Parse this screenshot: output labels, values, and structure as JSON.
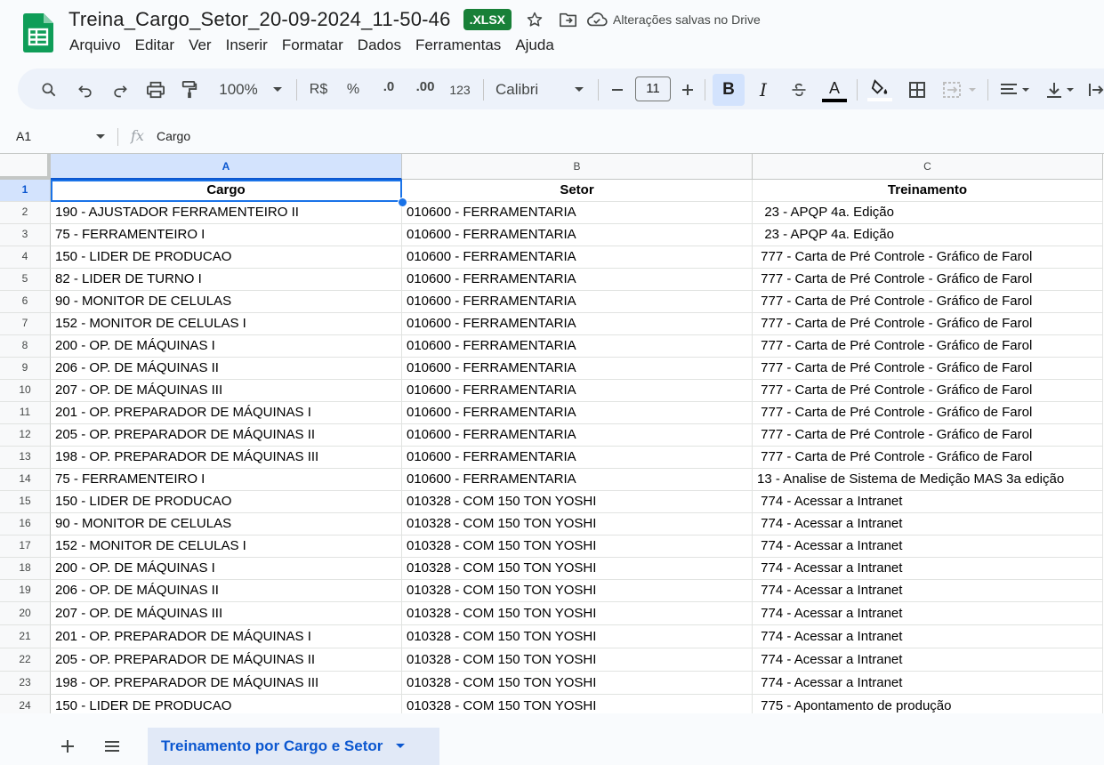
{
  "app": {
    "doc_title": "Treina_Cargo_Setor_20-09-2024_11-50-46",
    "format_badge": ".XLSX",
    "saved_status": "Alterações salvas no Drive"
  },
  "menu": [
    "Arquivo",
    "Editar",
    "Ver",
    "Inserir",
    "Formatar",
    "Dados",
    "Ferramentas",
    "Ajuda"
  ],
  "toolbar": {
    "zoom": "100%",
    "currency": "R$",
    "percent": "%",
    "decrease_decimal": ".0",
    "increase_decimal": ".00",
    "number_format": "123",
    "font": "Calibri",
    "font_size": "11",
    "bold": "B",
    "italic": "I",
    "text_color_label": "A",
    "text_color": "#000000"
  },
  "formula_bar": {
    "cell_ref": "A1",
    "fx": "fx",
    "value": "Cargo"
  },
  "columns": [
    "A",
    "B",
    "C"
  ],
  "rows": [
    {
      "n": "1",
      "a": "Cargo",
      "b": "Setor",
      "c": "Treinamento"
    },
    {
      "n": "2",
      "a": "190 - AJUSTADOR FERRAMENTEIRO II",
      "b": "010600 - FERRAMENTARIA",
      "c": "  23 - APQP 4a. Edição"
    },
    {
      "n": "3",
      "a": "75 - FERRAMENTEIRO I",
      "b": "010600 - FERRAMENTARIA",
      "c": "  23 - APQP 4a. Edição"
    },
    {
      "n": "4",
      "a": "150 - LIDER DE PRODUCAO",
      "b": "010600 - FERRAMENTARIA",
      "c": " 777 - Carta de Pré Controle - Gráfico de Farol"
    },
    {
      "n": "5",
      "a": "82 - LIDER DE TURNO I",
      "b": "010600 - FERRAMENTARIA",
      "c": " 777 - Carta de Pré Controle - Gráfico de Farol"
    },
    {
      "n": "6",
      "a": "90 - MONITOR DE CELULAS",
      "b": "010600 - FERRAMENTARIA",
      "c": " 777 - Carta de Pré Controle - Gráfico de Farol"
    },
    {
      "n": "7",
      "a": "152 - MONITOR DE CELULAS I",
      "b": "010600 - FERRAMENTARIA",
      "c": " 777 - Carta de Pré Controle - Gráfico de Farol"
    },
    {
      "n": "8",
      "a": "200 - OP. DE MÁQUINAS I",
      "b": "010600 - FERRAMENTARIA",
      "c": " 777 - Carta de Pré Controle - Gráfico de Farol"
    },
    {
      "n": "9",
      "a": "206 - OP. DE MÁQUINAS II",
      "b": "010600 - FERRAMENTARIA",
      "c": " 777 - Carta de Pré Controle - Gráfico de Farol"
    },
    {
      "n": "10",
      "a": "207 - OP. DE MÁQUINAS III",
      "b": "010600 - FERRAMENTARIA",
      "c": " 777 - Carta de Pré Controle - Gráfico de Farol"
    },
    {
      "n": "11",
      "a": "201 - OP. PREPARADOR DE MÁQUINAS I",
      "b": "010600 - FERRAMENTARIA",
      "c": " 777 - Carta de Pré Controle - Gráfico de Farol"
    },
    {
      "n": "12",
      "a": "205 - OP. PREPARADOR DE MÁQUINAS II",
      "b": "010600 - FERRAMENTARIA",
      "c": " 777 - Carta de Pré Controle - Gráfico de Farol"
    },
    {
      "n": "13",
      "a": "198 - OP. PREPARADOR DE MÁQUINAS III",
      "b": "010600 - FERRAMENTARIA",
      "c": " 777 - Carta de Pré Controle - Gráfico de Farol"
    },
    {
      "n": "14",
      "a": "75 - FERRAMENTEIRO I",
      "b": "010600 - FERRAMENTARIA",
      "c": "13 - Analise de Sistema de Medição MAS 3a edição"
    },
    {
      "n": "15",
      "a": "150 - LIDER DE PRODUCAO",
      "b": "010328 - COM 150 TON YOSHI",
      "c": " 774 - Acessar a Intranet"
    },
    {
      "n": "16",
      "a": "90 - MONITOR DE CELULAS",
      "b": "010328 - COM 150 TON YOSHI",
      "c": " 774 - Acessar a Intranet"
    },
    {
      "n": "17",
      "a": "152 - MONITOR DE CELULAS I",
      "b": "010328 - COM 150 TON YOSHI",
      "c": " 774 - Acessar a Intranet"
    },
    {
      "n": "18",
      "a": "200 - OP. DE MÁQUINAS I",
      "b": "010328 - COM 150 TON YOSHI",
      "c": " 774 - Acessar a Intranet"
    },
    {
      "n": "19",
      "a": "206 - OP. DE MÁQUINAS II",
      "b": "010328 - COM 150 TON YOSHI",
      "c": " 774 - Acessar a Intranet"
    },
    {
      "n": "20",
      "a": "207 - OP. DE MÁQUINAS III",
      "b": "010328 - COM 150 TON YOSHI",
      "c": " 774 - Acessar a Intranet"
    },
    {
      "n": "21",
      "a": "201 - OP. PREPARADOR DE MÁQUINAS I",
      "b": "010328 - COM 150 TON YOSHI",
      "c": " 774 - Acessar a Intranet"
    },
    {
      "n": "22",
      "a": "205 - OP. PREPARADOR DE MÁQUINAS II",
      "b": "010328 - COM 150 TON YOSHI",
      "c": " 774 - Acessar a Intranet"
    },
    {
      "n": "23",
      "a": "198 - OP. PREPARADOR DE MÁQUINAS III",
      "b": "010328 - COM 150 TON YOSHI",
      "c": " 774 - Acessar a Intranet"
    },
    {
      "n": "24",
      "a": "150 - LIDER DE PRODUCAO",
      "b": "010328 - COM 150 TON YOSHI",
      "c": " 775 - Apontamento de produção"
    }
  ],
  "sheet_tab": {
    "name": "Treinamento por Cargo e Setor"
  },
  "colors": {
    "accent": "#0b57d0",
    "badge": "#188038",
    "selection": "#1a73e8",
    "logo": "#0f9d58"
  },
  "icons": [
    "sheets-logo",
    "star-icon",
    "move-folder-icon",
    "cloud-saved-icon",
    "search-icon",
    "undo-icon",
    "redo-icon",
    "print-icon",
    "paint-format-icon",
    "chevron-down-icon",
    "minus-icon",
    "plus-icon",
    "strikethrough-icon",
    "fill-color-icon",
    "borders-icon",
    "merge-cells-icon",
    "align-horizontal-icon",
    "align-vertical-icon",
    "text-wrap-icon",
    "menu-icon"
  ]
}
